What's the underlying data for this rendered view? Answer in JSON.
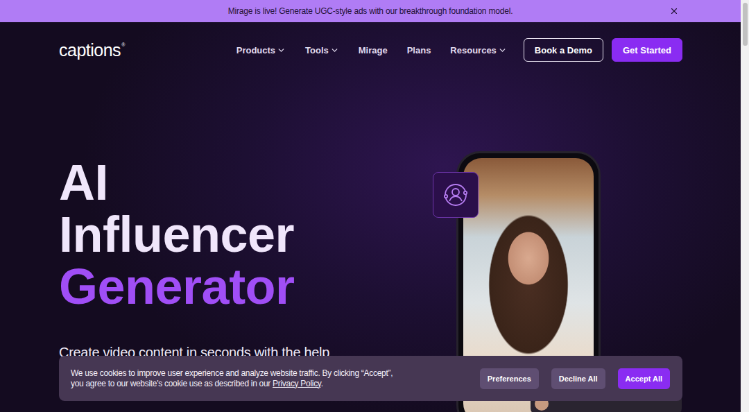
{
  "announcement": {
    "text": "Mirage is live! Generate UGC-style ads with our breakthrough foundation model."
  },
  "logo": {
    "text": "captions",
    "mark": "®"
  },
  "nav": {
    "items": [
      {
        "label": "Products",
        "dropdown": true
      },
      {
        "label": "Tools",
        "dropdown": true
      },
      {
        "label": "Mirage",
        "dropdown": false
      },
      {
        "label": "Plans",
        "dropdown": false
      },
      {
        "label": "Resources",
        "dropdown": true
      }
    ],
    "buttons": [
      {
        "label": "Book a Demo",
        "kind": "outline"
      },
      {
        "label": "Get Started",
        "kind": "primary"
      }
    ]
  },
  "hero": {
    "title": [
      {
        "text": "AI",
        "accent": false
      },
      {
        "text": "Influencer",
        "accent": false
      },
      {
        "text": "Generator",
        "accent": true
      }
    ],
    "subtitle": "Create video content in seconds with the help"
  },
  "cookie_banner": {
    "lines": [
      "We use cookies to improve user experience and analyze website traffic. By clicking “Accept”,",
      "you agree to our website's cookie use as described in our "
    ],
    "link": "Privacy Policy",
    "end": ".",
    "buttons": [
      {
        "label": "Preferences",
        "kind": "secondary"
      },
      {
        "label": "Decline All",
        "kind": "secondary"
      },
      {
        "label": "Accept All",
        "kind": "primary"
      }
    ]
  }
}
